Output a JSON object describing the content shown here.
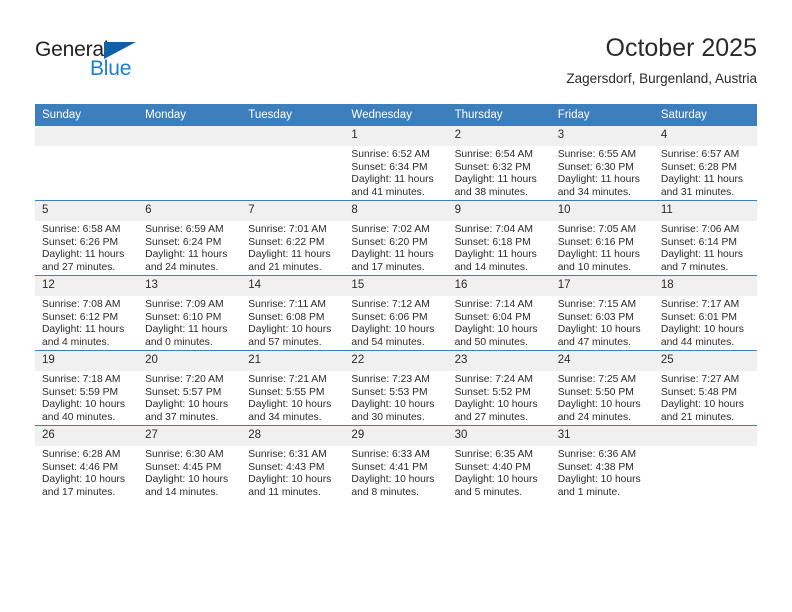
{
  "brand": {
    "name_part1": "General",
    "name_part2": "Blue",
    "triangle_color": "#1060a8",
    "blue_color": "#1b7fd4"
  },
  "header": {
    "title": "October 2025",
    "location": "Zagersdorf, Burgenland, Austria"
  },
  "theme": {
    "header_row_bg": "#3d7ebd",
    "daynum_bg": "#f0f0f0",
    "row_divider": "#3d7ebd",
    "text": "#2b2b2b"
  },
  "calendar": {
    "weekday_headers": [
      "Sunday",
      "Monday",
      "Tuesday",
      "Wednesday",
      "Thursday",
      "Friday",
      "Saturday"
    ],
    "weeks": [
      [
        {
          "day": "",
          "sunrise": "",
          "sunset": "",
          "daylight_line1": "",
          "daylight_line2": ""
        },
        {
          "day": "",
          "sunrise": "",
          "sunset": "",
          "daylight_line1": "",
          "daylight_line2": ""
        },
        {
          "day": "",
          "sunrise": "",
          "sunset": "",
          "daylight_line1": "",
          "daylight_line2": ""
        },
        {
          "day": "1",
          "sunrise": "Sunrise: 6:52 AM",
          "sunset": "Sunset: 6:34 PM",
          "daylight_line1": "Daylight: 11 hours",
          "daylight_line2": "and 41 minutes."
        },
        {
          "day": "2",
          "sunrise": "Sunrise: 6:54 AM",
          "sunset": "Sunset: 6:32 PM",
          "daylight_line1": "Daylight: 11 hours",
          "daylight_line2": "and 38 minutes."
        },
        {
          "day": "3",
          "sunrise": "Sunrise: 6:55 AM",
          "sunset": "Sunset: 6:30 PM",
          "daylight_line1": "Daylight: 11 hours",
          "daylight_line2": "and 34 minutes."
        },
        {
          "day": "4",
          "sunrise": "Sunrise: 6:57 AM",
          "sunset": "Sunset: 6:28 PM",
          "daylight_line1": "Daylight: 11 hours",
          "daylight_line2": "and 31 minutes."
        }
      ],
      [
        {
          "day": "5",
          "sunrise": "Sunrise: 6:58 AM",
          "sunset": "Sunset: 6:26 PM",
          "daylight_line1": "Daylight: 11 hours",
          "daylight_line2": "and 27 minutes."
        },
        {
          "day": "6",
          "sunrise": "Sunrise: 6:59 AM",
          "sunset": "Sunset: 6:24 PM",
          "daylight_line1": "Daylight: 11 hours",
          "daylight_line2": "and 24 minutes."
        },
        {
          "day": "7",
          "sunrise": "Sunrise: 7:01 AM",
          "sunset": "Sunset: 6:22 PM",
          "daylight_line1": "Daylight: 11 hours",
          "daylight_line2": "and 21 minutes."
        },
        {
          "day": "8",
          "sunrise": "Sunrise: 7:02 AM",
          "sunset": "Sunset: 6:20 PM",
          "daylight_line1": "Daylight: 11 hours",
          "daylight_line2": "and 17 minutes."
        },
        {
          "day": "9",
          "sunrise": "Sunrise: 7:04 AM",
          "sunset": "Sunset: 6:18 PM",
          "daylight_line1": "Daylight: 11 hours",
          "daylight_line2": "and 14 minutes."
        },
        {
          "day": "10",
          "sunrise": "Sunrise: 7:05 AM",
          "sunset": "Sunset: 6:16 PM",
          "daylight_line1": "Daylight: 11 hours",
          "daylight_line2": "and 10 minutes."
        },
        {
          "day": "11",
          "sunrise": "Sunrise: 7:06 AM",
          "sunset": "Sunset: 6:14 PM",
          "daylight_line1": "Daylight: 11 hours",
          "daylight_line2": "and 7 minutes."
        }
      ],
      [
        {
          "day": "12",
          "sunrise": "Sunrise: 7:08 AM",
          "sunset": "Sunset: 6:12 PM",
          "daylight_line1": "Daylight: 11 hours",
          "daylight_line2": "and 4 minutes."
        },
        {
          "day": "13",
          "sunrise": "Sunrise: 7:09 AM",
          "sunset": "Sunset: 6:10 PM",
          "daylight_line1": "Daylight: 11 hours",
          "daylight_line2": "and 0 minutes."
        },
        {
          "day": "14",
          "sunrise": "Sunrise: 7:11 AM",
          "sunset": "Sunset: 6:08 PM",
          "daylight_line1": "Daylight: 10 hours",
          "daylight_line2": "and 57 minutes."
        },
        {
          "day": "15",
          "sunrise": "Sunrise: 7:12 AM",
          "sunset": "Sunset: 6:06 PM",
          "daylight_line1": "Daylight: 10 hours",
          "daylight_line2": "and 54 minutes."
        },
        {
          "day": "16",
          "sunrise": "Sunrise: 7:14 AM",
          "sunset": "Sunset: 6:04 PM",
          "daylight_line1": "Daylight: 10 hours",
          "daylight_line2": "and 50 minutes."
        },
        {
          "day": "17",
          "sunrise": "Sunrise: 7:15 AM",
          "sunset": "Sunset: 6:03 PM",
          "daylight_line1": "Daylight: 10 hours",
          "daylight_line2": "and 47 minutes."
        },
        {
          "day": "18",
          "sunrise": "Sunrise: 7:17 AM",
          "sunset": "Sunset: 6:01 PM",
          "daylight_line1": "Daylight: 10 hours",
          "daylight_line2": "and 44 minutes."
        }
      ],
      [
        {
          "day": "19",
          "sunrise": "Sunrise: 7:18 AM",
          "sunset": "Sunset: 5:59 PM",
          "daylight_line1": "Daylight: 10 hours",
          "daylight_line2": "and 40 minutes."
        },
        {
          "day": "20",
          "sunrise": "Sunrise: 7:20 AM",
          "sunset": "Sunset: 5:57 PM",
          "daylight_line1": "Daylight: 10 hours",
          "daylight_line2": "and 37 minutes."
        },
        {
          "day": "21",
          "sunrise": "Sunrise: 7:21 AM",
          "sunset": "Sunset: 5:55 PM",
          "daylight_line1": "Daylight: 10 hours",
          "daylight_line2": "and 34 minutes."
        },
        {
          "day": "22",
          "sunrise": "Sunrise: 7:23 AM",
          "sunset": "Sunset: 5:53 PM",
          "daylight_line1": "Daylight: 10 hours",
          "daylight_line2": "and 30 minutes."
        },
        {
          "day": "23",
          "sunrise": "Sunrise: 7:24 AM",
          "sunset": "Sunset: 5:52 PM",
          "daylight_line1": "Daylight: 10 hours",
          "daylight_line2": "and 27 minutes."
        },
        {
          "day": "24",
          "sunrise": "Sunrise: 7:25 AM",
          "sunset": "Sunset: 5:50 PM",
          "daylight_line1": "Daylight: 10 hours",
          "daylight_line2": "and 24 minutes."
        },
        {
          "day": "25",
          "sunrise": "Sunrise: 7:27 AM",
          "sunset": "Sunset: 5:48 PM",
          "daylight_line1": "Daylight: 10 hours",
          "daylight_line2": "and 21 minutes."
        }
      ],
      [
        {
          "day": "26",
          "sunrise": "Sunrise: 6:28 AM",
          "sunset": "Sunset: 4:46 PM",
          "daylight_line1": "Daylight: 10 hours",
          "daylight_line2": "and 17 minutes."
        },
        {
          "day": "27",
          "sunrise": "Sunrise: 6:30 AM",
          "sunset": "Sunset: 4:45 PM",
          "daylight_line1": "Daylight: 10 hours",
          "daylight_line2": "and 14 minutes."
        },
        {
          "day": "28",
          "sunrise": "Sunrise: 6:31 AM",
          "sunset": "Sunset: 4:43 PM",
          "daylight_line1": "Daylight: 10 hours",
          "daylight_line2": "and 11 minutes."
        },
        {
          "day": "29",
          "sunrise": "Sunrise: 6:33 AM",
          "sunset": "Sunset: 4:41 PM",
          "daylight_line1": "Daylight: 10 hours",
          "daylight_line2": "and 8 minutes."
        },
        {
          "day": "30",
          "sunrise": "Sunrise: 6:35 AM",
          "sunset": "Sunset: 4:40 PM",
          "daylight_line1": "Daylight: 10 hours",
          "daylight_line2": "and 5 minutes."
        },
        {
          "day": "31",
          "sunrise": "Sunrise: 6:36 AM",
          "sunset": "Sunset: 4:38 PM",
          "daylight_line1": "Daylight: 10 hours",
          "daylight_line2": "and 1 minute."
        },
        {
          "day": "",
          "sunrise": "",
          "sunset": "",
          "daylight_line1": "",
          "daylight_line2": ""
        }
      ]
    ]
  }
}
